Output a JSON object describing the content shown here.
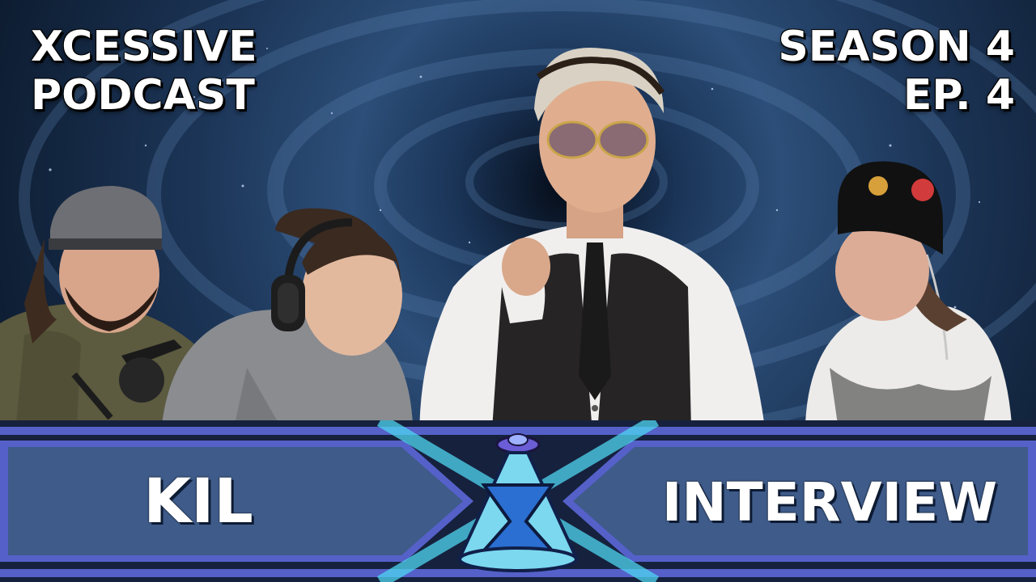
{
  "header": {
    "show_line1": "XCESSIVE",
    "show_line2": "PODCAST",
    "season": "SEASON 4",
    "episode": "EP. 4"
  },
  "banner": {
    "guest": "KIL",
    "episode_type": "INTERVIEW"
  },
  "icons": [
    "xcessive-logo-icon",
    "microphone-icon",
    "headphones-icon"
  ],
  "colors": {
    "banner_panel": "#3e5b8a",
    "banner_border": "#5561c9",
    "banner_dark": "#16213d",
    "logo_cyan": "#4fd6f0",
    "text": "#ffffff"
  }
}
